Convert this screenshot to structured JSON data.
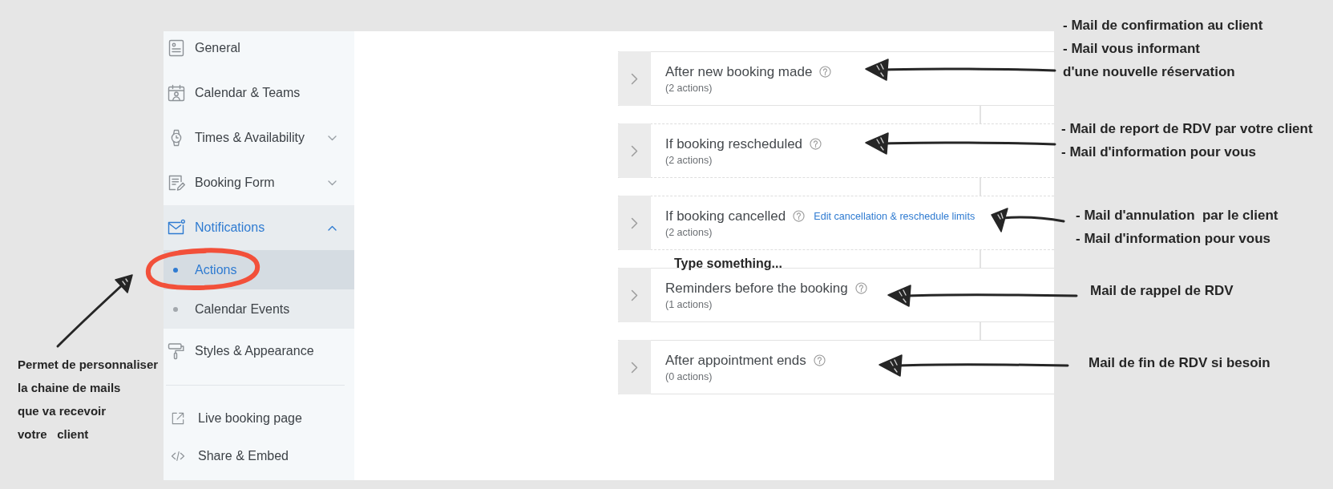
{
  "sidebar": {
    "nav": [
      {
        "label": "General",
        "selected": false
      },
      {
        "label": "Calendar & Teams",
        "selected": false
      },
      {
        "label": "Times & Availability",
        "selected": false,
        "expanded": false
      },
      {
        "label": "Booking Form",
        "selected": false,
        "expanded": false
      },
      {
        "label": "Notifications",
        "selected": true,
        "expanded": true,
        "children": [
          {
            "label": "Actions",
            "selected": true
          },
          {
            "label": "Calendar Events",
            "selected": false
          }
        ]
      },
      {
        "label": "Styles & Appearance",
        "selected": false
      }
    ],
    "links": [
      {
        "label": "Live booking page"
      },
      {
        "label": "Share & Embed"
      }
    ]
  },
  "triggers": [
    {
      "title": "After new booking made",
      "count": "(2 actions)",
      "kind": "solid",
      "expanded": false
    },
    {
      "title": "If booking rescheduled",
      "count": "(2 actions)",
      "kind": "dashed",
      "expanded": false
    },
    {
      "title": "If booking cancelled",
      "count": "(2 actions)",
      "kind": "dashed",
      "expanded": false,
      "link": "Edit cancellation & reschedule limits"
    },
    {
      "title": "Reminders before the booking",
      "count": "(1 actions)",
      "kind": "solid",
      "expanded": false
    },
    {
      "title": "After appointment ends",
      "count": "(0 actions)",
      "kind": "solid",
      "expanded": false
    }
  ],
  "annotations": [
    {
      "lines": [
        "- Mail de confirmation au client",
        "- Mail vous informant",
        "d'une nouvelle réservation"
      ]
    },
    {
      "lines": [
        "- Mail de report de RDV par votre client",
        "- Mail d'information pour vous"
      ]
    },
    {
      "lines": [
        "- Mail d'annulation  par le client",
        "- Mail d'information pour vous"
      ]
    },
    {
      "lines": [
        "Mail de rappel de RDV"
      ]
    },
    {
      "lines": [
        "Mail de fin de RDV si besoin"
      ]
    },
    {
      "lines": [
        "Type something..."
      ]
    },
    {
      "lines": [
        "Permet de personnaliser",
        "la chaine de mails",
        "que va recevoir",
        "votre   client"
      ]
    }
  ]
}
